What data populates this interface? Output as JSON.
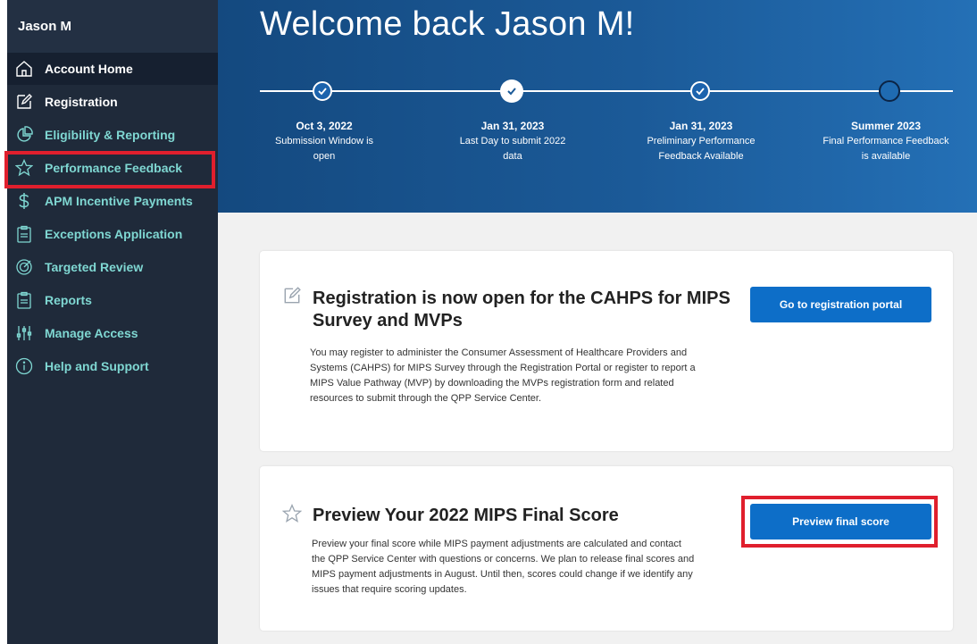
{
  "sidebar": {
    "user_name": "Jason M",
    "items": [
      {
        "label": "Account Home",
        "icon": "home-icon"
      },
      {
        "label": "Registration",
        "icon": "edit-icon"
      },
      {
        "label": "Eligibility & Reporting",
        "icon": "pie-chart-icon"
      },
      {
        "label": "Performance Feedback",
        "icon": "star-icon"
      },
      {
        "label": "APM Incentive Payments",
        "icon": "dollar-icon"
      },
      {
        "label": "Exceptions Application",
        "icon": "clipboard-icon"
      },
      {
        "label": "Targeted Review",
        "icon": "target-icon"
      },
      {
        "label": "Reports",
        "icon": "clipboard-icon"
      },
      {
        "label": "Manage Access",
        "icon": "sliders-icon"
      },
      {
        "label": "Help and Support",
        "icon": "info-icon"
      }
    ]
  },
  "hero": {
    "title": "Welcome back Jason M!",
    "steps": [
      {
        "date": "Oct 3, 2022",
        "desc": "Submission Window is open"
      },
      {
        "date": "Jan 31, 2023",
        "desc": "Last Day to submit 2022 data"
      },
      {
        "date": "Jan 31, 2023",
        "desc": "Preliminary Performance Feedback Available"
      },
      {
        "date": "Summer 2023",
        "desc": "Final Performance Feedback is available"
      }
    ]
  },
  "cards": {
    "registration": {
      "title": "Registration is now open for the CAHPS for MIPS Survey and MVPs",
      "body": "You may register to administer the Consumer Assessment of Healthcare Providers and Systems (CAHPS) for MIPS Survey through the Registration Portal or register to report a MIPS Value Pathway (MVP) by downloading the MVPs registration form and related resources to submit through the QPP Service Center.",
      "button": "Go to registration portal"
    },
    "preview": {
      "title": "Preview Your 2022 MIPS Final Score",
      "body": "Preview your final score while MIPS payment adjustments are calculated and contact the QPP Service Center with questions or concerns. We plan to release final scores and MIPS payment adjustments in August. Until then, scores could change if we identify any issues that require scoring updates.",
      "button": "Preview final score"
    }
  },
  "colors": {
    "sidebar_bg": "#1f2a3a",
    "nav_text": "#7fd7d2",
    "hero_blue": "#1b5a98",
    "button_blue": "#0d6ec8",
    "highlight_red": "#e01f2d"
  }
}
